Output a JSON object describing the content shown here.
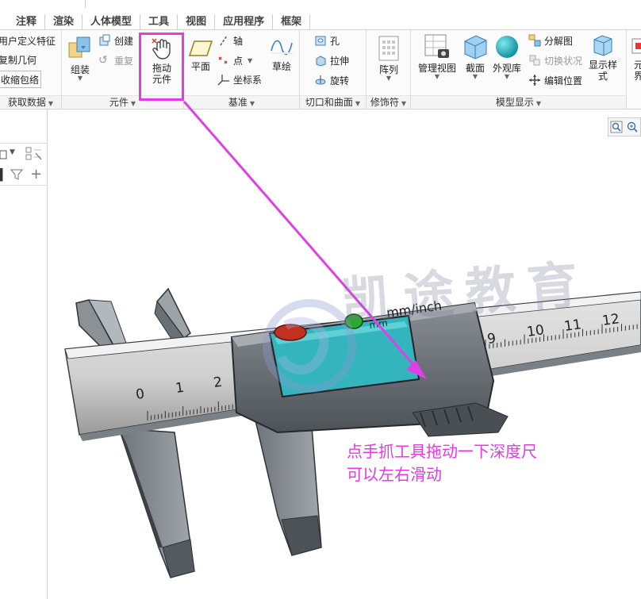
{
  "tabs": [
    "注释",
    "渲染",
    "人体模型",
    "工具",
    "视图",
    "应用程序",
    "框架"
  ],
  "ribbon": {
    "get_data": {
      "items": [
        "用户定义特征",
        "复制几何",
        "收缩包络"
      ],
      "label": "获取数据"
    },
    "components": {
      "assemble": "组装",
      "create": "创建",
      "repeat": "重复",
      "drag_line1": "拖动",
      "drag_line2": "元件",
      "label": "元件"
    },
    "datum": {
      "plane": "平面",
      "axis": "轴",
      "point": "点",
      "csys": "坐标系",
      "sketch": "草绘",
      "label": "基准"
    },
    "cut_surface": {
      "hole": "孔",
      "extrude": "拉伸",
      "revolve": "旋转",
      "label": "切口和曲面"
    },
    "modifiers": {
      "pattern": "阵列",
      "label": "修饰符"
    },
    "model_display": {
      "manage_views": "管理视图",
      "section": "截面",
      "appearance": "外观库",
      "explode": "分解图",
      "toggle_status": "切换状况",
      "edit_position": "编辑位置",
      "display_style_line1": "显示样",
      "display_style_line2": "式",
      "label": "模型显示"
    },
    "cut_off": {
      "line1": "元",
      "line2": "界"
    }
  },
  "caliper": {
    "unit_label": "mm/inch",
    "scale_top": [
      "9",
      "10",
      "11",
      "12"
    ],
    "scale_bottom": [
      "0",
      "1",
      "2"
    ],
    "lcd_text": "mm"
  },
  "watermark": "凯途教育",
  "annotation": {
    "line1": "点手抓工具拖动一下深度尺",
    "line2": "可以左右滑动"
  },
  "colors": {
    "highlight": "#e33be6",
    "annotation": "#e639e3",
    "arrow": "#e03fe6",
    "lcd": "#2ca3ad",
    "button_red": "#c23020",
    "button_green": "#2aa830"
  }
}
